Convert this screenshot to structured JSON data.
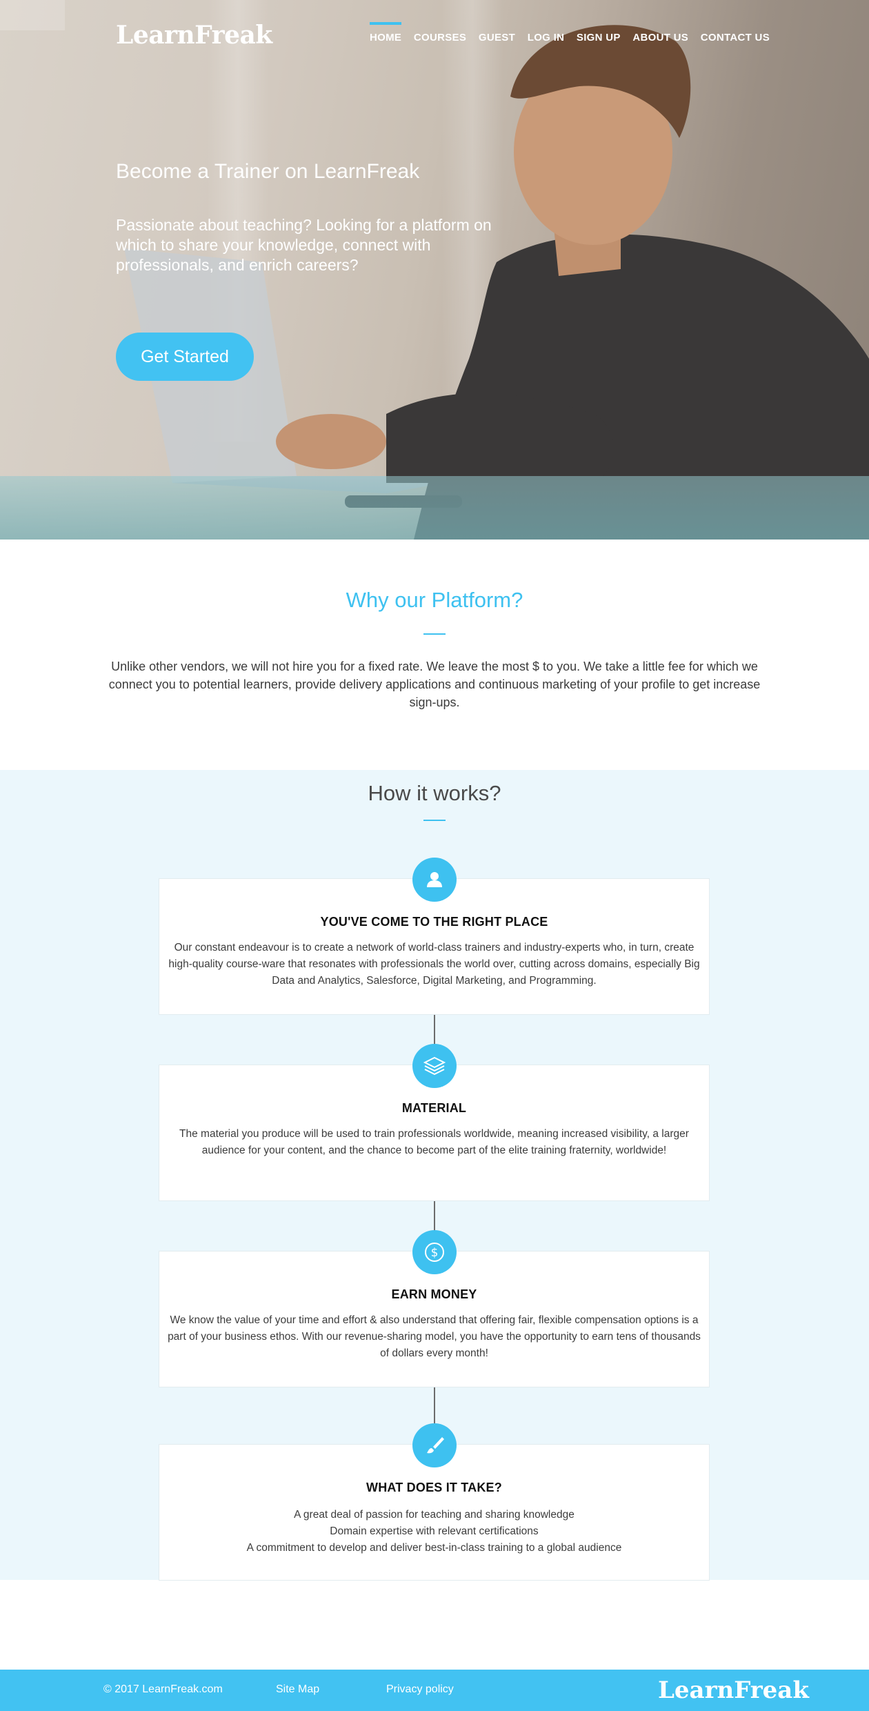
{
  "brand": {
    "logo_text": "LearnFreak"
  },
  "nav": {
    "items": [
      {
        "label": "HOME",
        "active": true
      },
      {
        "label": "COURSES",
        "active": false
      },
      {
        "label": "GUEST",
        "active": false
      },
      {
        "label": "LOG IN",
        "active": false
      },
      {
        "label": "SIGN UP",
        "active": false
      },
      {
        "label": "ABOUT US",
        "active": false
      },
      {
        "label": "CONTACT US",
        "active": false
      }
    ]
  },
  "hero": {
    "title": "Become a Trainer on LearnFreak",
    "subtitle": "Passionate about teaching? Looking for a platform on which to share your knowledge, connect with professionals, and enrich careers?",
    "cta_label": "Get Started"
  },
  "why": {
    "title": "Why our Platform?",
    "text": "Unlike other vendors, we will not hire you for a fixed rate. We leave the most $ to you. We take a little fee for which we connect you to potential learners, provide delivery applications and continuous marketing of your profile to get increase sign-ups."
  },
  "how": {
    "title": "How it works?",
    "steps": [
      {
        "icon": "user-icon",
        "title": "YOU'VE COME TO THE RIGHT PLACE",
        "text": "Our constant endeavour is to create a network of world-class trainers and industry-experts who, in turn, create high-quality course-ware that resonates with professionals the world over, cutting across domains, especially Big Data and Analytics, Salesforce, Digital Marketing, and Programming."
      },
      {
        "icon": "layers-icon",
        "title": "MATERIAL",
        "text": "The material you produce will be used to train professionals worldwide, meaning increased visibility, a larger audience for your content, and the chance to become part of the elite training fraternity, worldwide!"
      },
      {
        "icon": "dollar-icon",
        "title": "EARN MONEY",
        "text": "We know the value of your time and effort & also understand that offering fair, flexible compensation options is a part of your business ethos. With our revenue-sharing model, you have the opportunity to earn tens of thousands of dollars every month!"
      },
      {
        "icon": "brush-icon",
        "title": "WHAT DOES IT TAKE?",
        "items": [
          "A great deal of passion for teaching and sharing knowledge",
          "Domain expertise with relevant certifications",
          "A commitment to develop and deliver best-in-class training to a global audience"
        ]
      }
    ]
  },
  "footer": {
    "copyright": "© 2017 LearnFreak.com",
    "sitemap_label": "Site Map",
    "privacy_label": "Privacy policy",
    "logo_text": "LearnFreak"
  },
  "colors": {
    "accent": "#42c2f2",
    "section_bg": "#ebf7fc",
    "footer_bg": "#42c2f2"
  }
}
